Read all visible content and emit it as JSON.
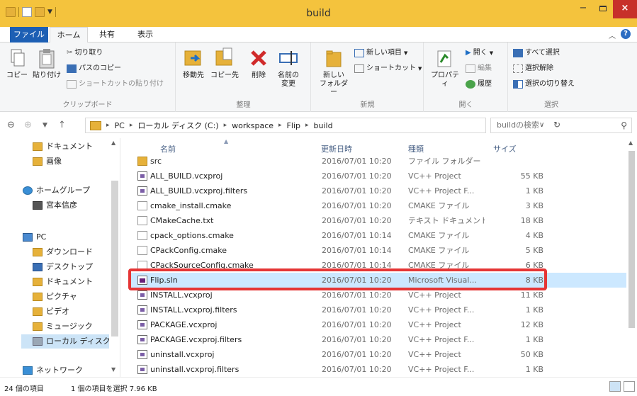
{
  "window": {
    "title": "build",
    "minimize": "−",
    "close": "×"
  },
  "ribbon_tabs": {
    "file": "ファイル",
    "home": "ホーム",
    "share": "共有",
    "view": "表示"
  },
  "ribbon": {
    "clipboard": {
      "label": "クリップボード",
      "copy": "コピー",
      "paste": "貼り付け",
      "cut": "切り取り",
      "copy_path": "パスのコピー",
      "paste_shortcut": "ショートカットの貼り付け"
    },
    "organize": {
      "label": "整理",
      "move_to": "移動先",
      "copy_to": "コピー先",
      "delete": "削除",
      "rename_line1": "名前の",
      "rename_line2": "変更"
    },
    "new": {
      "label": "新規",
      "new_folder_line1": "新しい",
      "new_folder_line2": "フォルダー",
      "new_item": "新しい項目",
      "shortcut": "ショートカット"
    },
    "open": {
      "label": "開く",
      "properties": "プロパティ",
      "open": "開く",
      "edit": "編集",
      "history": "履歴"
    },
    "select": {
      "label": "選択",
      "select_all": "すべて選択",
      "select_none": "選択解除",
      "invert": "選択の切り替え"
    }
  },
  "address": {
    "crumbs": [
      "PC",
      "ローカル ディスク (C:)",
      "workspace",
      "Flip",
      "build"
    ],
    "search_placeholder": "buildの検索"
  },
  "sidebar": {
    "items": [
      {
        "label": "ドキュメント",
        "icon": "documents-folder-icon"
      },
      {
        "label": "画像",
        "icon": "pictures-folder-icon"
      },
      {
        "label": "ホームグループ",
        "icon": "homegroup-icon"
      },
      {
        "label": "宮本信彦",
        "icon": "user-icon"
      },
      {
        "label": "PC",
        "icon": "pc-icon"
      },
      {
        "label": "ダウンロード",
        "icon": "downloads-folder-icon"
      },
      {
        "label": "デスクトップ",
        "icon": "desktop-folder-icon"
      },
      {
        "label": "ドキュメント",
        "icon": "documents-folder-icon"
      },
      {
        "label": "ピクチャ",
        "icon": "pictures-folder-icon"
      },
      {
        "label": "ビデオ",
        "icon": "videos-folder-icon"
      },
      {
        "label": "ミュージック",
        "icon": "music-folder-icon"
      },
      {
        "label": "ローカル ディスク (C",
        "icon": "local-disk-icon"
      },
      {
        "label": "ネットワーク",
        "icon": "network-icon"
      }
    ]
  },
  "columns": {
    "name": "名前",
    "date": "更新日時",
    "type": "種類",
    "size": "サイズ"
  },
  "files": [
    {
      "name": "src",
      "date": "2016/07/01 10:20",
      "type": "ファイル フォルダー",
      "size": "",
      "icon": "folder"
    },
    {
      "name": "ALL_BUILD.vcxproj",
      "date": "2016/07/01 10:20",
      "type": "VC++ Project",
      "size": "55 KB",
      "icon": "vc"
    },
    {
      "name": "ALL_BUILD.vcxproj.filters",
      "date": "2016/07/01 10:20",
      "type": "VC++ Project F...",
      "size": "1 KB",
      "icon": "vc"
    },
    {
      "name": "cmake_install.cmake",
      "date": "2016/07/01 10:20",
      "type": "CMAKE ファイル",
      "size": "3 KB",
      "icon": "doc"
    },
    {
      "name": "CMakeCache.txt",
      "date": "2016/07/01 10:20",
      "type": "テキスト ドキュメント",
      "size": "18 KB",
      "icon": "doc"
    },
    {
      "name": "cpack_options.cmake",
      "date": "2016/07/01 10:14",
      "type": "CMAKE ファイル",
      "size": "4 KB",
      "icon": "doc"
    },
    {
      "name": "CPackConfig.cmake",
      "date": "2016/07/01 10:14",
      "type": "CMAKE ファイル",
      "size": "5 KB",
      "icon": "doc"
    },
    {
      "name": "CPackSourceConfig.cmake",
      "date": "2016/07/01 10:14",
      "type": "CMAKE ファイル",
      "size": "6 KB",
      "icon": "doc"
    },
    {
      "name": "Flip.sln",
      "date": "2016/07/01 10:20",
      "type": "Microsoft Visual...",
      "size": "8 KB",
      "icon": "sln",
      "selected": true
    },
    {
      "name": "INSTALL.vcxproj",
      "date": "2016/07/01 10:20",
      "type": "VC++ Project",
      "size": "11 KB",
      "icon": "vc"
    },
    {
      "name": "INSTALL.vcxproj.filters",
      "date": "2016/07/01 10:20",
      "type": "VC++ Project F...",
      "size": "1 KB",
      "icon": "vc"
    },
    {
      "name": "PACKAGE.vcxproj",
      "date": "2016/07/01 10:20",
      "type": "VC++ Project",
      "size": "12 KB",
      "icon": "vc"
    },
    {
      "name": "PACKAGE.vcxproj.filters",
      "date": "2016/07/01 10:20",
      "type": "VC++ Project F...",
      "size": "1 KB",
      "icon": "vc"
    },
    {
      "name": "uninstall.vcxproj",
      "date": "2016/07/01 10:20",
      "type": "VC++ Project",
      "size": "50 KB",
      "icon": "vc"
    },
    {
      "name": "uninstall.vcxproj.filters",
      "date": "2016/07/01 10:20",
      "type": "VC++ Project F...",
      "size": "1 KB",
      "icon": "vc"
    }
  ],
  "status": {
    "item_count": "24 個の項目",
    "selection": "1 個の項目を選択 7.96 KB"
  },
  "colors": {
    "title_bar": "#f4c33d",
    "file_tab": "#1d5fb4",
    "close_button": "#c7302a",
    "highlight_box": "#e53535",
    "selected_row": "#cce8ff"
  }
}
